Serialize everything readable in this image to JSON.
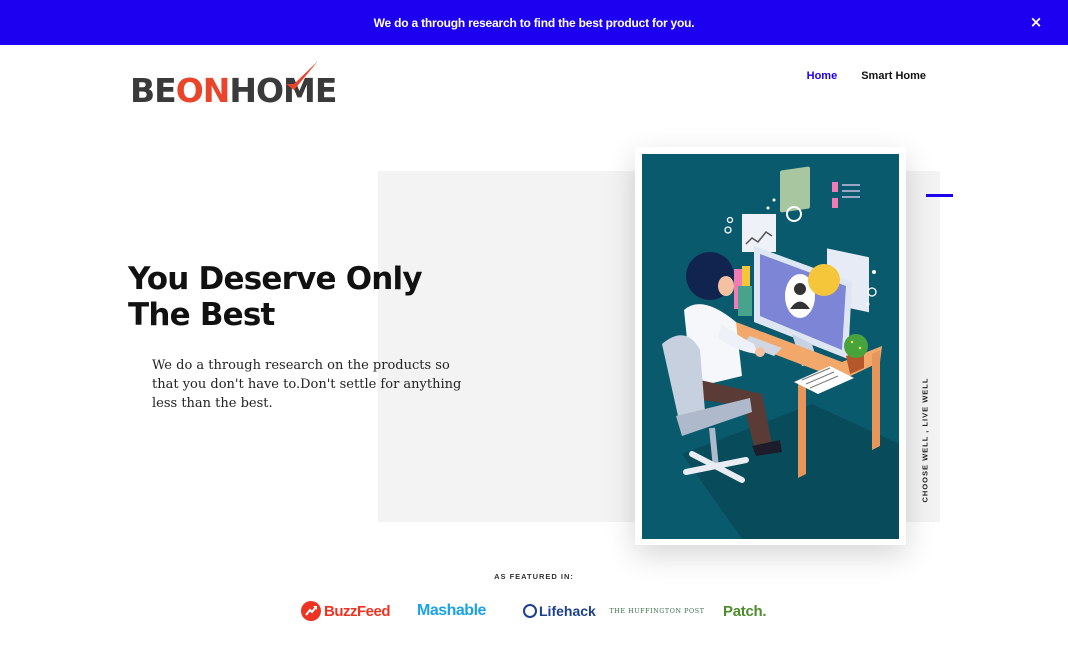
{
  "announcement": {
    "text": "We do a through research to find the best product for you.",
    "close_label": "×"
  },
  "logo": {
    "part1": "BE",
    "part2": "ON",
    "part3": "HOME",
    "colors": {
      "dark": "#3a3a3a",
      "accent": "#e8452a"
    }
  },
  "nav": {
    "items": [
      {
        "label": "Home",
        "active": true
      },
      {
        "label": "Smart Home",
        "active": false
      }
    ]
  },
  "hero": {
    "title": "You Deserve Only The Best",
    "description": "We do a through research on the products so that you don't have to.Don't settle for anything less than the best.",
    "image_icon": "person-at-computer-illustration",
    "side_text": "CHOOSE WELL , LIVE WELL"
  },
  "featured": {
    "label": "AS FEATURED IN:",
    "brands": [
      "BuzzFeed",
      "Mashable",
      "Lifehack",
      "THE HUFFINGTON POST",
      "Patch."
    ]
  },
  "colors": {
    "brand_blue": "#1d00f0",
    "panel_grey": "#f3f3f3",
    "illustration_bg": "#0a5a6e"
  }
}
